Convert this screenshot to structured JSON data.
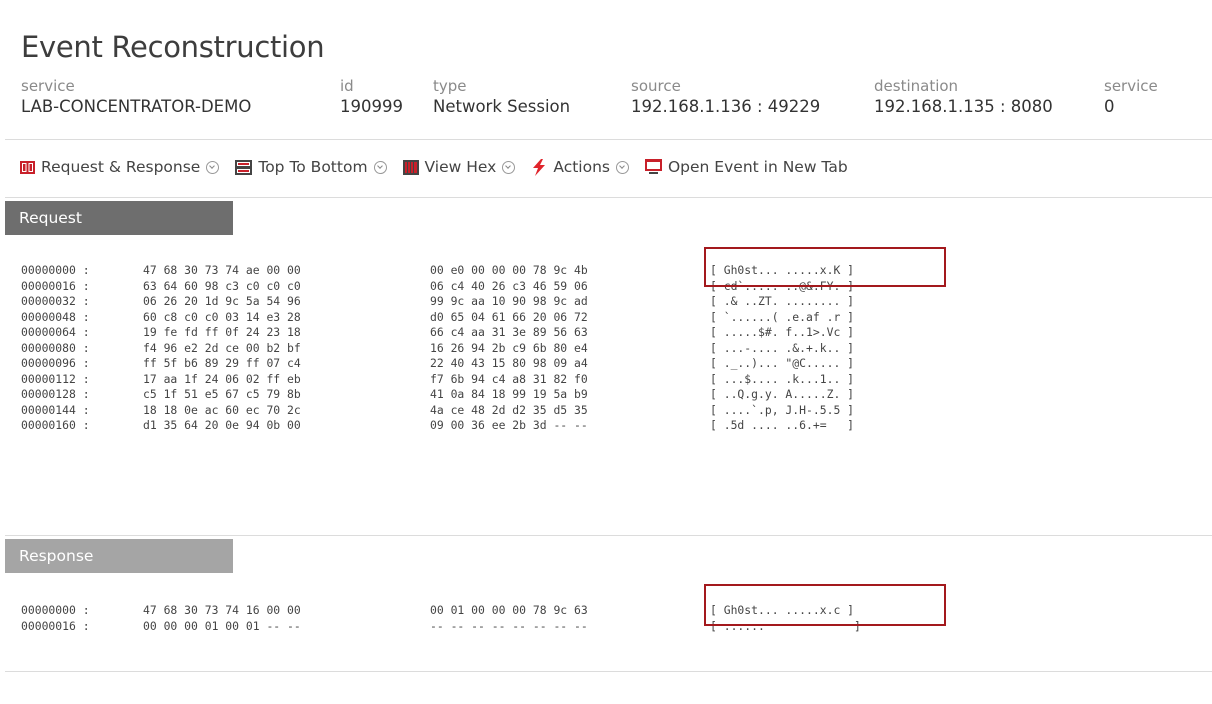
{
  "title": "Event Reconstruction",
  "meta": [
    {
      "label": "service",
      "value": "LAB-CONCENTRATOR-DEMO"
    },
    {
      "label": "id",
      "value": "190999"
    },
    {
      "label": "type",
      "value": "Network Session"
    },
    {
      "label": "source",
      "value": "192.168.1.136 : 49229"
    },
    {
      "label": "destination",
      "value": "192.168.1.135 : 8080"
    },
    {
      "label": "service",
      "value": "0"
    }
  ],
  "toolbar": {
    "request_response": "Request & Response",
    "top_to_bottom": "Top To Bottom",
    "view_hex": "View Hex",
    "actions": "Actions",
    "open_new_tab": "Open Event in New Tab"
  },
  "colors": {
    "request_header": "#6e6e6e",
    "response_header": "#a5a5a5",
    "highlight": "#a3191d",
    "icon_red": "#c8202a",
    "icon_dark": "#444444"
  },
  "request": {
    "label": "Request",
    "rows": [
      {
        "offset": "00000000 :",
        "b1": "47 68 30 73 74 ae 00 00",
        "b2": "00 e0 00 00 00 78 9c 4b",
        "ascii": "[ Gh0st... .....x.K ]"
      },
      {
        "offset": "00000016 :",
        "b1": "63 64 60 98 c3 c0 c0 c0",
        "b2": "06 c4 40 26 c3 46 59 06",
        "ascii": "[ cd`..... ..@&.FY. ]"
      },
      {
        "offset": "00000032 :",
        "b1": "06 26 20 1d 9c 5a 54 96",
        "b2": "99 9c aa 10 90 98 9c ad",
        "ascii": "[ .& ..ZT. ........ ]"
      },
      {
        "offset": "00000048 :",
        "b1": "60 c8 c0 c0 03 14 e3 28",
        "b2": "d0 65 04 61 66 20 06 72",
        "ascii": "[ `......( .e.af .r ]"
      },
      {
        "offset": "00000064 :",
        "b1": "19 fe fd ff 0f 24 23 18",
        "b2": "66 c4 aa 31 3e 89 56 63",
        "ascii": "[ .....$#. f..1>.Vc ]"
      },
      {
        "offset": "00000080 :",
        "b1": "f4 96 e2 2d ce 00 b2 bf",
        "b2": "16 26 94 2b c9 6b 80 e4",
        "ascii": "[ ...-.... .&.+.k.. ]"
      },
      {
        "offset": "00000096 :",
        "b1": "ff 5f b6 89 29 ff 07 c4",
        "b2": "22 40 43 15 80 98 09 a4",
        "ascii": "[ ._..)... \"@C..... ]"
      },
      {
        "offset": "00000112 :",
        "b1": "17 aa 1f 24 06 02 ff eb",
        "b2": "f7 6b 94 c4 a8 31 82 f0",
        "ascii": "[ ...$.... .k...1.. ]"
      },
      {
        "offset": "00000128 :",
        "b1": "c5 1f 51 e5 67 c5 79 8b",
        "b2": "41 0a 84 18 99 19 5a b9",
        "ascii": "[ ..Q.g.y. A.....Z. ]"
      },
      {
        "offset": "00000144 :",
        "b1": "18 18 0e ac 60 ec 70 2c",
        "b2": "4a ce 48 2d d2 35 d5 35",
        "ascii": "[ ....`.p, J.H-.5.5 ]"
      },
      {
        "offset": "00000160 :",
        "b1": "d1 35 64 20 0e 94 0b 00",
        "b2": "09 00 36 ee 2b 3d -- --",
        "ascii": "[ .5d .... ..6.+=   ]"
      }
    ]
  },
  "response": {
    "label": "Response",
    "rows": [
      {
        "offset": "00000000 :",
        "b1": "47 68 30 73 74 16 00 00",
        "b2": "00 01 00 00 00 78 9c 63",
        "ascii": "[ Gh0st... .....x.c ]"
      },
      {
        "offset": "00000016 :",
        "b1": "00 00 00 01 00 01 -- --",
        "b2": "-- -- -- -- -- -- -- --",
        "ascii": "[ ......             ]"
      }
    ]
  }
}
